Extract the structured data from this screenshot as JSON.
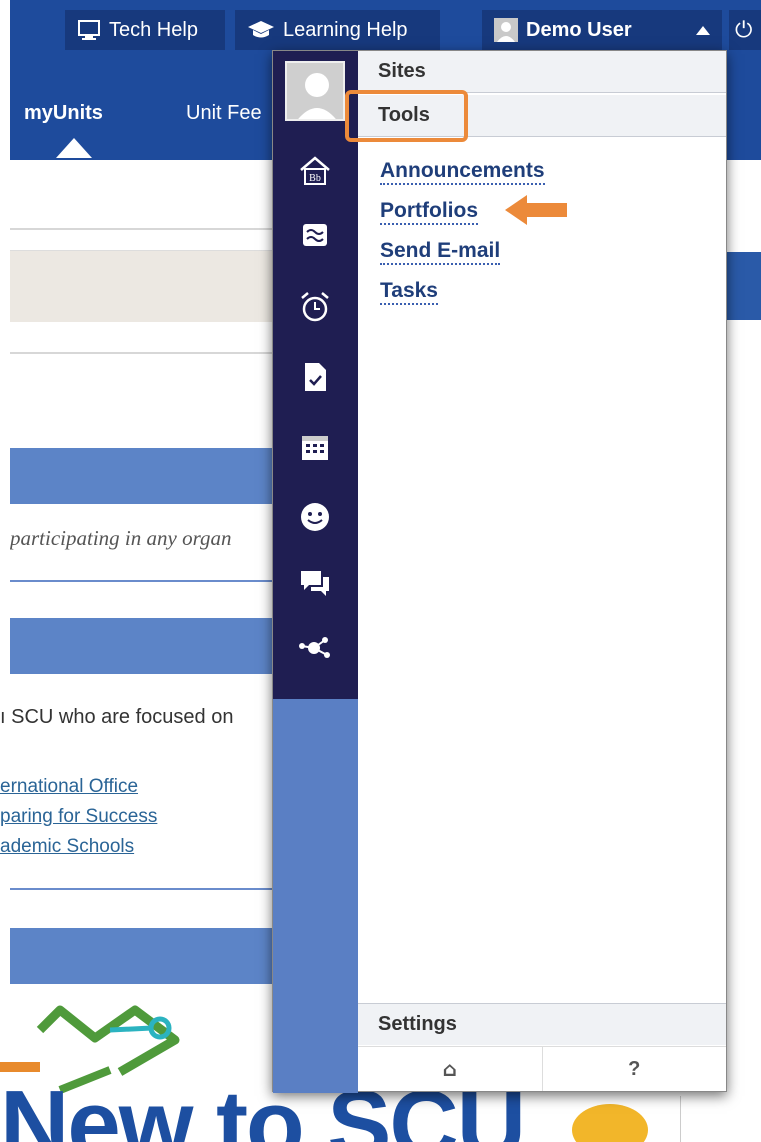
{
  "topbar": {
    "tech_help": "Tech Help",
    "learning_help": "Learning Help",
    "user_name": "Demo User",
    "power_glyph": "⏻"
  },
  "nav": {
    "tabs": [
      {
        "label": "myUnits",
        "active": true
      },
      {
        "label": "Unit Fee"
      }
    ]
  },
  "background": {
    "italic_text": "participating in any organ",
    "body_text": "ı SCU who are focused on",
    "links": [
      "ernational Office",
      "paring for Success",
      "ademic Schools"
    ],
    "logo_text": "New to SCU"
  },
  "menu": {
    "rail_icons": [
      "home-bb-icon",
      "activity-stream-icon",
      "alarm-clock-icon",
      "grades-document-icon",
      "calendar-icon",
      "smiley-icon",
      "messages-icon",
      "network-icon"
    ],
    "sites_header": "Sites",
    "tools_header": "Tools",
    "tools": [
      "Announcements",
      "Portfolios",
      "Send E-mail",
      "Tasks"
    ],
    "settings_header": "Settings",
    "footer": {
      "home_glyph": "⌂",
      "help_glyph": "?"
    }
  },
  "colors": {
    "brand_blue": "#1e4b9c",
    "rail_dark": "#1f1e52",
    "rail_light": "#5a7fc4",
    "highlight_orange": "#ec8a3a"
  }
}
